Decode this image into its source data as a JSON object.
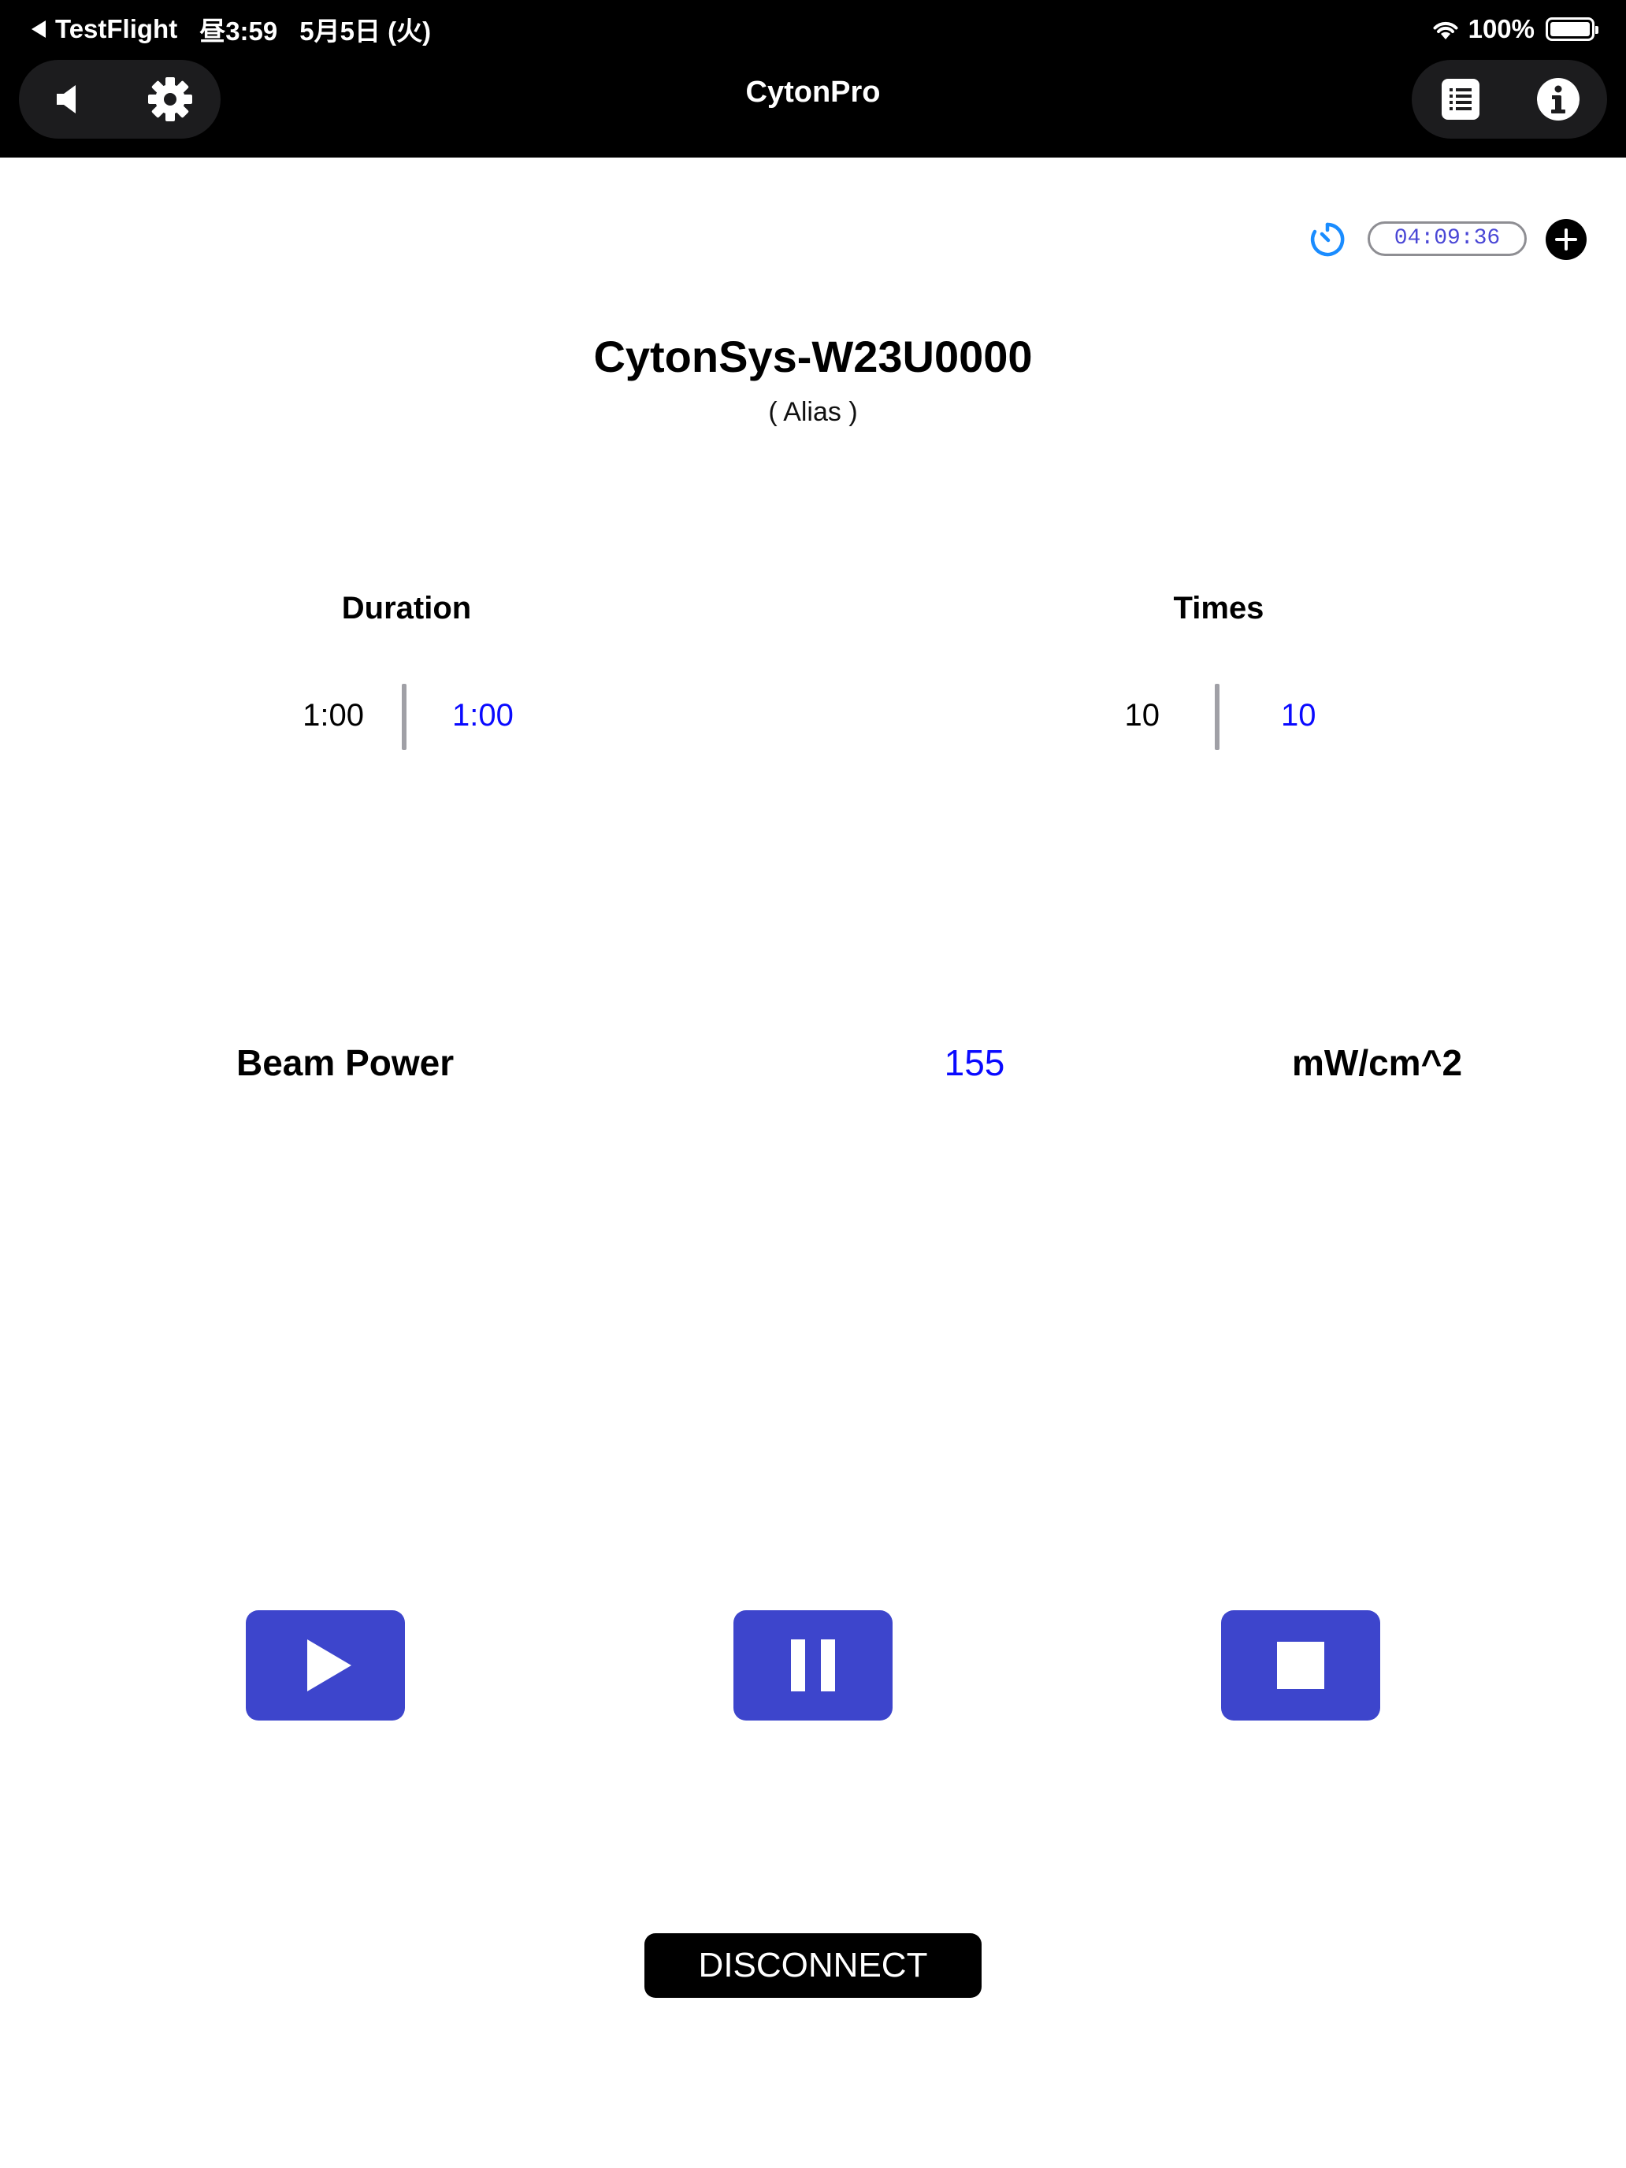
{
  "status_bar": {
    "back_app": "TestFlight",
    "time": "昼3:59",
    "date": "5月5日 (火)",
    "battery": "100%",
    "battery_level": 1.0
  },
  "nav": {
    "title": "CytonPro",
    "left_icons": [
      "speaker-icon",
      "gear-icon"
    ],
    "right_icons": [
      "list-icon",
      "info-icon"
    ]
  },
  "session": {
    "timer": "04:09:36",
    "timer_icon": "timer-icon",
    "add_icon": "plus-icon"
  },
  "device": {
    "name": "CytonSys-W23U0000",
    "alias": "( Alias )"
  },
  "duration": {
    "label": "Duration",
    "current": "1:00",
    "setting": "1:00"
  },
  "times": {
    "label": "Times",
    "current": "10",
    "setting": "10"
  },
  "beam_power": {
    "label": "Beam Power",
    "value": "155",
    "unit": "mW/cm^2"
  },
  "controls": {
    "play_icon": "play-icon",
    "pause_icon": "pause-icon",
    "stop_icon": "stop-icon",
    "disconnect_label": "DISCONNECT"
  },
  "colors": {
    "accent": "#3d45cc",
    "value_blue": "#0a0aff",
    "timer_text": "#4a47d6",
    "timer_icon": "#1a8cff"
  }
}
